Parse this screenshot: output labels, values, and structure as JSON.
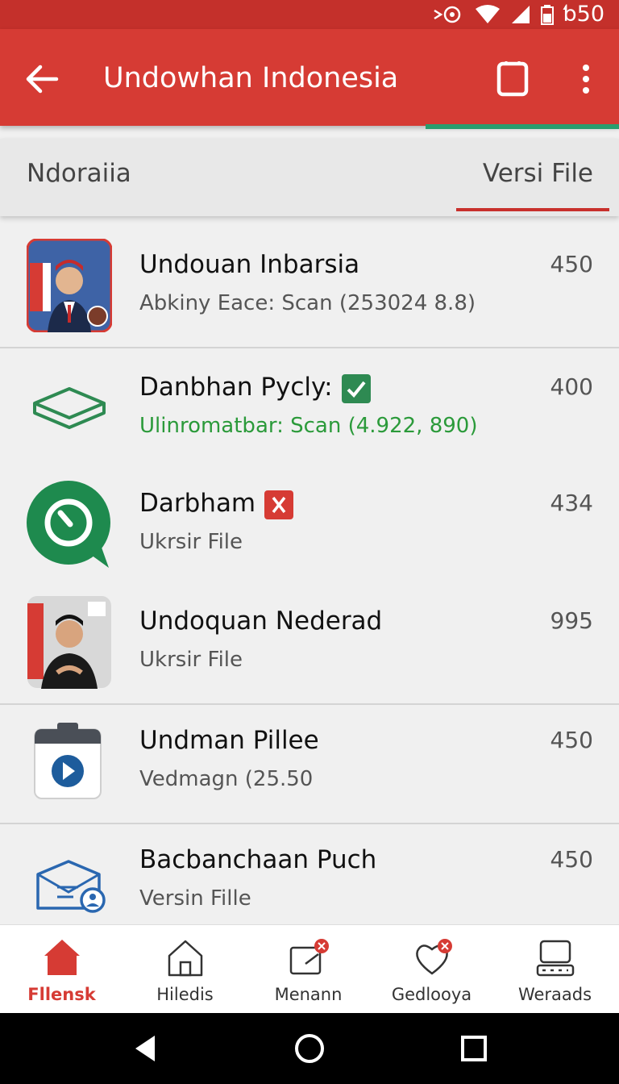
{
  "status_bar": {
    "time": "ƅ50"
  },
  "app_bar": {
    "title": "Undowhan Indonesia"
  },
  "tabs": [
    {
      "label": "Ndoraiia"
    },
    {
      "label": "Versi File",
      "active": true
    }
  ],
  "list": [
    {
      "title": "Undouan Inbarsia",
      "subtitle": "Abkiny Eace: Scan (253024 8.8)",
      "value": "450",
      "icon": "portrait-thumbnail"
    },
    {
      "title": "Danbhan Pycly:",
      "subtitle": "Ulinromatbar: Scan (4.922, 890)",
      "value": "400",
      "icon": "box-icon",
      "badge": "check-badge-icon",
      "subtitle_color": "#2b9a3a"
    },
    {
      "title": "Darbham",
      "subtitle": "Ukrsir File",
      "value": "434",
      "icon": "chat-clock-icon",
      "badge": "alert-badge-icon"
    },
    {
      "title": "Undoquan Nederad",
      "subtitle": "Ukrsir File",
      "value": "995",
      "icon": "portrait-thumbnail"
    },
    {
      "title": "Undman Pillee",
      "subtitle": "Vedmagn (25.50",
      "value": "450",
      "icon": "video-file-icon"
    },
    {
      "title": "Bacbanchaan Puch",
      "subtitle": "Versin Fille",
      "value": "450",
      "icon": "mail-user-icon"
    }
  ],
  "bottom_nav": [
    {
      "label": "Fllensk",
      "icon": "home-icon",
      "active": true
    },
    {
      "label": "Hiledis",
      "icon": "house-outline-icon"
    },
    {
      "label": "Menann",
      "icon": "message-icon"
    },
    {
      "label": "Gedlooya",
      "icon": "heart-icon"
    },
    {
      "label": "Weraads",
      "icon": "keyboard-icon"
    }
  ],
  "colors": {
    "primary": "#d63b34",
    "accent": "#2a9d6e",
    "green_text": "#2b9a3a"
  }
}
